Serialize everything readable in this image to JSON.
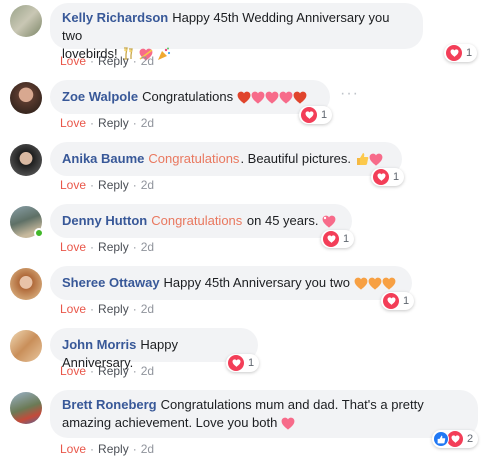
{
  "comments": [
    {
      "name": "Kelly Richardson",
      "tag": "",
      "text_line1": "Happy 45th Wedding Anniversary you two",
      "text_line2": "lovebirds!",
      "emojis": [
        "champagne-glasses-emoji",
        "heart-with-ribbon-emoji",
        "party-popper-emoji"
      ],
      "reaction_count": "1",
      "love_label": "Love",
      "reply_label": "Reply",
      "time": "2d"
    },
    {
      "name": "Zoe Walpole",
      "tag": "",
      "text": "Congratulations",
      "emojis": [
        "heart-emoji",
        "heart-emoji",
        "heart-emoji",
        "heart-emoji",
        "heart-emoji"
      ],
      "reaction_count": "1",
      "love_label": "Love",
      "reply_label": "Reply",
      "time": "2d"
    },
    {
      "name": "Anika Baume",
      "tag": "Congratulations",
      "text": ". Beautiful pictures.",
      "emojis": [
        "thumbs-up-emoji",
        "heart-emoji"
      ],
      "reaction_count": "1",
      "love_label": "Love",
      "reply_label": "Reply",
      "time": "2d"
    },
    {
      "name": "Denny Hutton",
      "tag": "Congratulations",
      "text": "on 45 years.",
      "emojis": [
        "sparkling-heart-emoji"
      ],
      "reaction_count": "1",
      "love_label": "Love",
      "reply_label": "Reply",
      "time": "2d"
    },
    {
      "name": "Sheree Ottaway",
      "tag": "",
      "text": "Happy 45th Anniversary you two",
      "emojis": [
        "orange-heart-emoji",
        "orange-heart-emoji",
        "orange-heart-emoji"
      ],
      "reaction_count": "1",
      "love_label": "Love",
      "reply_label": "Reply",
      "time": "2d"
    },
    {
      "name": "John Morris",
      "tag": "",
      "text": "Happy Anniversary.",
      "emojis": [],
      "reaction_count": "1",
      "love_label": "Love",
      "reply_label": "Reply",
      "time": "2d"
    },
    {
      "name": "Brett Roneberg",
      "tag": "",
      "text_line1": "Congratulations mum and dad. That's a pretty",
      "text_line2": "amazing achievement. Love you both",
      "emojis": [
        "heart-emoji"
      ],
      "reaction_count": "2",
      "love_label": "Love",
      "reply_label": "Reply",
      "time": "2d"
    }
  ],
  "more_options": "···",
  "colors": {
    "name": "#385898",
    "tag": "#e9785f",
    "love_action": "#e9574a",
    "bubble": "#f2f3f5",
    "love_reaction": "#f33e58",
    "like_reaction": "#2078f4",
    "online": "#42b72a"
  }
}
